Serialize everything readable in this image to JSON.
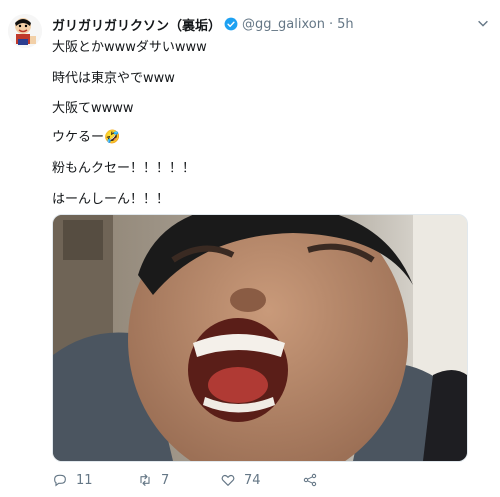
{
  "tweet": {
    "display_name": "ガリガリガリクソン（裏垢）",
    "handle": "@gg_galixon",
    "separator": "·",
    "time": "5h",
    "lines": [
      "大阪とかwwwダサいwww",
      "時代は東京やでwww",
      "大阪てwwww",
      "ウケるー🤣",
      "粉もんクセー！！！！！",
      "はーんしーん！！！"
    ]
  },
  "actions": {
    "reply_count": "11",
    "retweet_count": "7",
    "like_count": "74"
  },
  "icons": {
    "verified": "verified-badge-icon",
    "reply": "reply-icon",
    "retweet": "retweet-icon",
    "like": "heart-icon",
    "share": "share-icon",
    "more": "chevron-down-icon"
  },
  "colors": {
    "verified": "#1da1f2",
    "text": "#14171a",
    "secondary": "#657786"
  }
}
